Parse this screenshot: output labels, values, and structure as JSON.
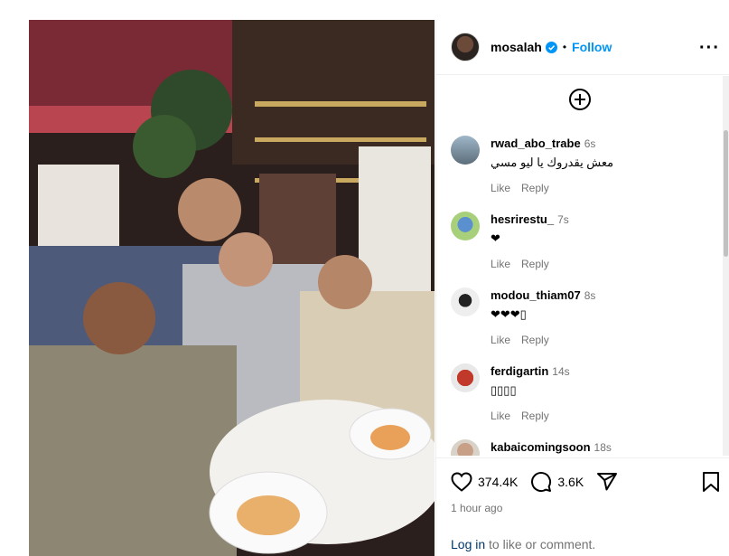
{
  "post": {
    "username": "mosalah",
    "follow_label": "Follow",
    "dot": "•",
    "more": "···"
  },
  "comments": [
    {
      "user": "rwad_abo_trabe",
      "time": "6s",
      "text": "معش يقدروك يا ليو مسي",
      "like": "Like",
      "reply": "Reply"
    },
    {
      "user": "hesrirestu_",
      "time": "7s",
      "text": "❤",
      "like": "Like",
      "reply": "Reply"
    },
    {
      "user": "modou_thiam07",
      "time": "8s",
      "text": "❤❤❤▯",
      "like": "Like",
      "reply": "Reply"
    },
    {
      "user": "ferdigartin",
      "time": "14s",
      "text": "▯▯▯▯",
      "like": "Like",
      "reply": "Reply"
    },
    {
      "user": "kabaicomingsoon",
      "time": "18s",
      "text": "",
      "like": "",
      "reply": ""
    }
  ],
  "stats": {
    "likes": "374.4K",
    "comments": "3.6K",
    "time_ago": "1 hour ago"
  },
  "login": {
    "link": "Log in",
    "rest": " to like or comment."
  },
  "colors": {
    "accent": "#0095f6",
    "muted": "#737373",
    "login_link": "#00376b"
  }
}
